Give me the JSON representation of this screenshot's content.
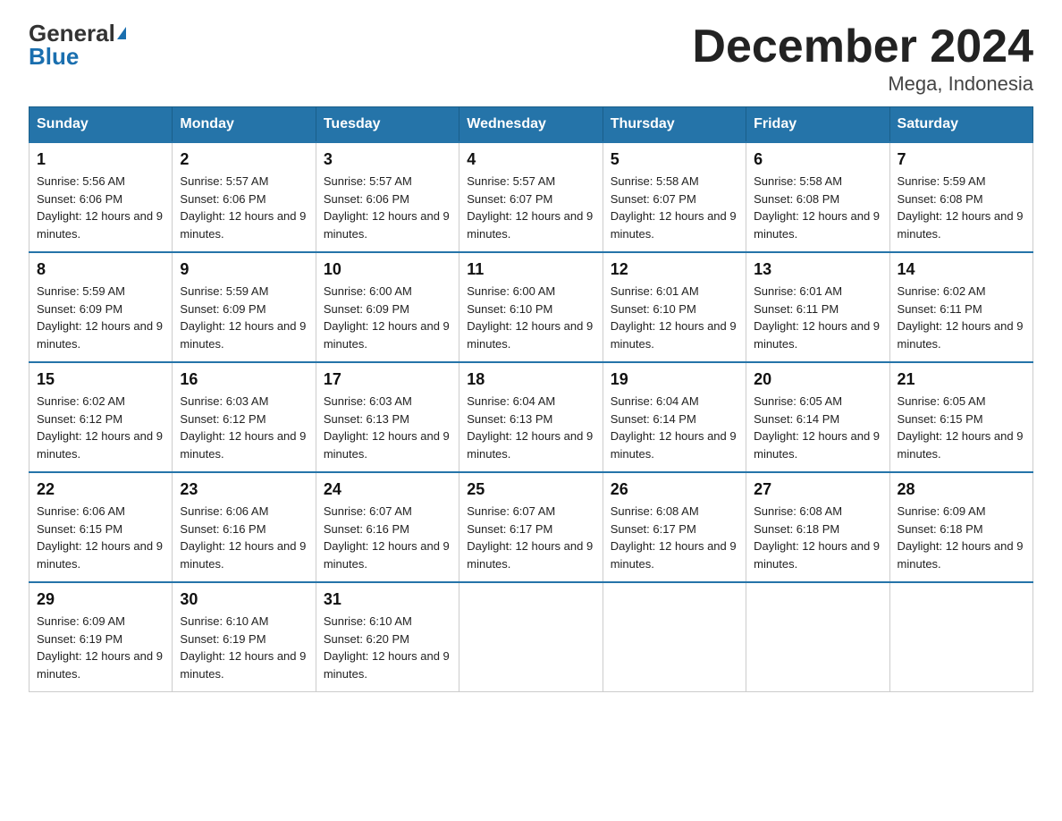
{
  "header": {
    "logo_general": "General",
    "logo_blue": "Blue",
    "month_title": "December 2024",
    "location": "Mega, Indonesia"
  },
  "days_of_week": [
    "Sunday",
    "Monday",
    "Tuesday",
    "Wednesday",
    "Thursday",
    "Friday",
    "Saturday"
  ],
  "weeks": [
    [
      {
        "day": "1",
        "sunrise": "5:56 AM",
        "sunset": "6:06 PM",
        "daylight": "12 hours and 9 minutes."
      },
      {
        "day": "2",
        "sunrise": "5:57 AM",
        "sunset": "6:06 PM",
        "daylight": "12 hours and 9 minutes."
      },
      {
        "day": "3",
        "sunrise": "5:57 AM",
        "sunset": "6:06 PM",
        "daylight": "12 hours and 9 minutes."
      },
      {
        "day": "4",
        "sunrise": "5:57 AM",
        "sunset": "6:07 PM",
        "daylight": "12 hours and 9 minutes."
      },
      {
        "day": "5",
        "sunrise": "5:58 AM",
        "sunset": "6:07 PM",
        "daylight": "12 hours and 9 minutes."
      },
      {
        "day": "6",
        "sunrise": "5:58 AM",
        "sunset": "6:08 PM",
        "daylight": "12 hours and 9 minutes."
      },
      {
        "day": "7",
        "sunrise": "5:59 AM",
        "sunset": "6:08 PM",
        "daylight": "12 hours and 9 minutes."
      }
    ],
    [
      {
        "day": "8",
        "sunrise": "5:59 AM",
        "sunset": "6:09 PM",
        "daylight": "12 hours and 9 minutes."
      },
      {
        "day": "9",
        "sunrise": "5:59 AM",
        "sunset": "6:09 PM",
        "daylight": "12 hours and 9 minutes."
      },
      {
        "day": "10",
        "sunrise": "6:00 AM",
        "sunset": "6:09 PM",
        "daylight": "12 hours and 9 minutes."
      },
      {
        "day": "11",
        "sunrise": "6:00 AM",
        "sunset": "6:10 PM",
        "daylight": "12 hours and 9 minutes."
      },
      {
        "day": "12",
        "sunrise": "6:01 AM",
        "sunset": "6:10 PM",
        "daylight": "12 hours and 9 minutes."
      },
      {
        "day": "13",
        "sunrise": "6:01 AM",
        "sunset": "6:11 PM",
        "daylight": "12 hours and 9 minutes."
      },
      {
        "day": "14",
        "sunrise": "6:02 AM",
        "sunset": "6:11 PM",
        "daylight": "12 hours and 9 minutes."
      }
    ],
    [
      {
        "day": "15",
        "sunrise": "6:02 AM",
        "sunset": "6:12 PM",
        "daylight": "12 hours and 9 minutes."
      },
      {
        "day": "16",
        "sunrise": "6:03 AM",
        "sunset": "6:12 PM",
        "daylight": "12 hours and 9 minutes."
      },
      {
        "day": "17",
        "sunrise": "6:03 AM",
        "sunset": "6:13 PM",
        "daylight": "12 hours and 9 minutes."
      },
      {
        "day": "18",
        "sunrise": "6:04 AM",
        "sunset": "6:13 PM",
        "daylight": "12 hours and 9 minutes."
      },
      {
        "day": "19",
        "sunrise": "6:04 AM",
        "sunset": "6:14 PM",
        "daylight": "12 hours and 9 minutes."
      },
      {
        "day": "20",
        "sunrise": "6:05 AM",
        "sunset": "6:14 PM",
        "daylight": "12 hours and 9 minutes."
      },
      {
        "day": "21",
        "sunrise": "6:05 AM",
        "sunset": "6:15 PM",
        "daylight": "12 hours and 9 minutes."
      }
    ],
    [
      {
        "day": "22",
        "sunrise": "6:06 AM",
        "sunset": "6:15 PM",
        "daylight": "12 hours and 9 minutes."
      },
      {
        "day": "23",
        "sunrise": "6:06 AM",
        "sunset": "6:16 PM",
        "daylight": "12 hours and 9 minutes."
      },
      {
        "day": "24",
        "sunrise": "6:07 AM",
        "sunset": "6:16 PM",
        "daylight": "12 hours and 9 minutes."
      },
      {
        "day": "25",
        "sunrise": "6:07 AM",
        "sunset": "6:17 PM",
        "daylight": "12 hours and 9 minutes."
      },
      {
        "day": "26",
        "sunrise": "6:08 AM",
        "sunset": "6:17 PM",
        "daylight": "12 hours and 9 minutes."
      },
      {
        "day": "27",
        "sunrise": "6:08 AM",
        "sunset": "6:18 PM",
        "daylight": "12 hours and 9 minutes."
      },
      {
        "day": "28",
        "sunrise": "6:09 AM",
        "sunset": "6:18 PM",
        "daylight": "12 hours and 9 minutes."
      }
    ],
    [
      {
        "day": "29",
        "sunrise": "6:09 AM",
        "sunset": "6:19 PM",
        "daylight": "12 hours and 9 minutes."
      },
      {
        "day": "30",
        "sunrise": "6:10 AM",
        "sunset": "6:19 PM",
        "daylight": "12 hours and 9 minutes."
      },
      {
        "day": "31",
        "sunrise": "6:10 AM",
        "sunset": "6:20 PM",
        "daylight": "12 hours and 9 minutes."
      },
      null,
      null,
      null,
      null
    ]
  ]
}
